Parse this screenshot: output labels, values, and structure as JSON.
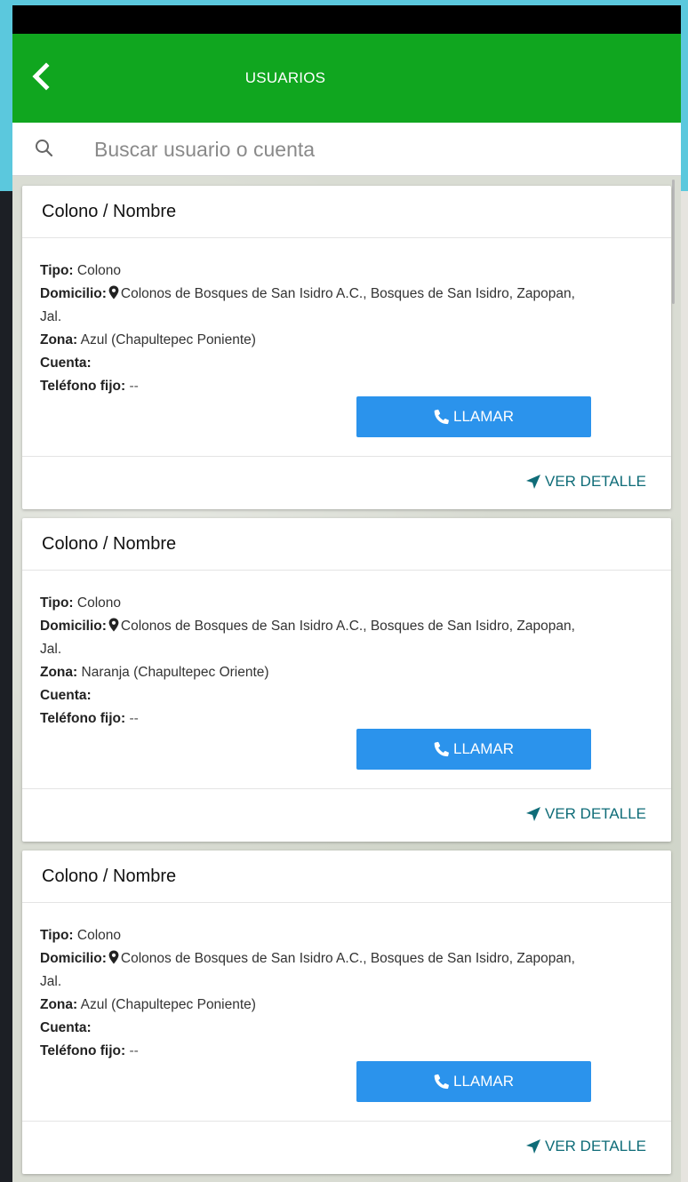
{
  "appbar": {
    "title": "USUARIOS",
    "back_icon": "chevron-left-icon"
  },
  "search": {
    "placeholder": "Buscar usuario o cuenta",
    "value": "",
    "icon": "search-icon"
  },
  "colors": {
    "appbar": "#10a61f",
    "status_bar": "#000000",
    "button": "#2b93ec",
    "link": "#0f6c78"
  },
  "labels": {
    "tipo": "Tipo:",
    "domicilio": "Domicilio:",
    "zona": "Zona:",
    "cuenta": "Cuenta:",
    "telefono": "Teléfono fijo:",
    "call_button": "LLAMAR",
    "detail_link": "VER DETALLE"
  },
  "users": [
    {
      "name": "Colono / Nombre",
      "tipo": "Colono",
      "domicilio_line1": "Colonos de Bosques de San Isidro A.C., Bosques de San Isidro, Zapopan,",
      "domicilio_line2": "Jal.",
      "zona": "Azul (Chapultepec Poniente)",
      "cuenta": "",
      "telefono": "--"
    },
    {
      "name": "Colono / Nombre",
      "tipo": "Colono",
      "domicilio_line1": "Colonos de Bosques de San Isidro A.C., Bosques de San Isidro, Zapopan,",
      "domicilio_line2": "Jal.",
      "zona": "Naranja (Chapultepec Oriente)",
      "cuenta": "",
      "telefono": "--"
    },
    {
      "name": "Colono / Nombre",
      "tipo": "Colono",
      "domicilio_line1": "Colonos de Bosques de San Isidro A.C., Bosques de San Isidro, Zapopan,",
      "domicilio_line2": "Jal.",
      "zona": "Azul (Chapultepec Poniente)",
      "cuenta": "",
      "telefono": "--"
    }
  ]
}
